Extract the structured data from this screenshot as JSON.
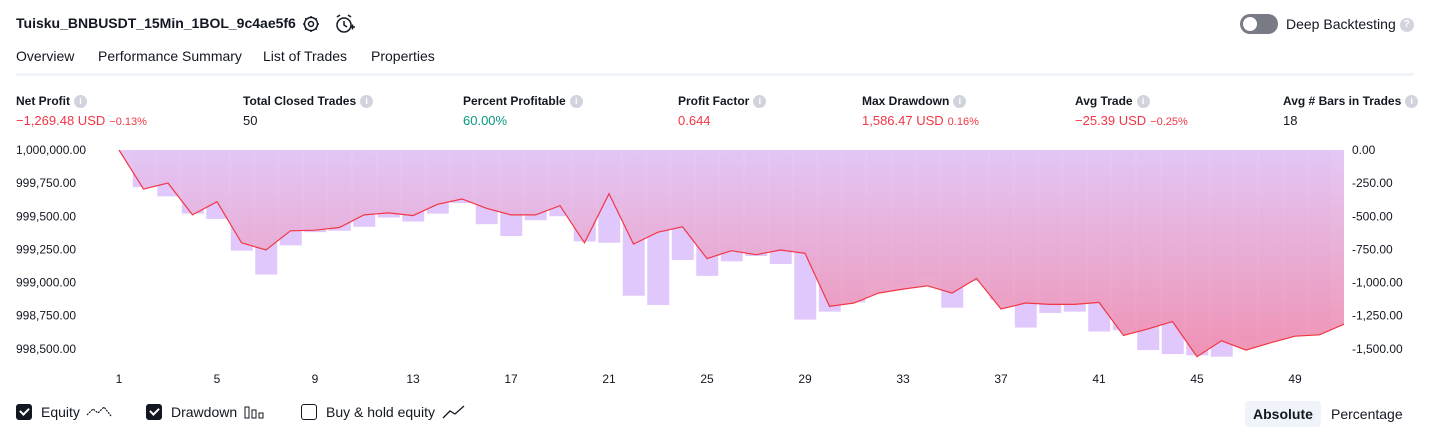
{
  "header": {
    "strategy_name": "Tuisku_BNBUSDT_15Min_1BOL_9c4ae5f6",
    "settings_icon": "gear-icon",
    "alert_icon": "add-alert-icon",
    "deep_backtesting_label": "Deep Backtesting",
    "deep_backtesting_enabled": false,
    "help_icon": "question-icon"
  },
  "tabs": [
    {
      "label": "Overview",
      "active": true
    },
    {
      "label": "Performance Summary",
      "active": false
    },
    {
      "label": "List of Trades",
      "active": false
    },
    {
      "label": "Properties",
      "active": false
    }
  ],
  "metrics": [
    {
      "label": "Net Profit",
      "value": "−1,269.48 USD",
      "sub": "−0.13%",
      "color": "#f23645"
    },
    {
      "label": "Total Closed Trades",
      "value": "50",
      "sub": "",
      "color": "#131722"
    },
    {
      "label": "Percent Profitable",
      "value": "60.00%",
      "sub": "",
      "color": "#089981"
    },
    {
      "label": "Profit Factor",
      "value": "0.644",
      "sub": "",
      "color": "#f23645"
    },
    {
      "label": "Max Drawdown",
      "value": "1,586.47 USD",
      "sub": "0.16%",
      "color": "#f23645"
    },
    {
      "label": "Avg Trade",
      "value": "−25.39 USD",
      "sub": "−0.25%",
      "color": "#f23645"
    },
    {
      "label": "Avg # Bars in Trades",
      "value": "18",
      "sub": "",
      "color": "#131722"
    }
  ],
  "legend": {
    "equity": {
      "label": "Equity",
      "checked": true,
      "icon": "equity-line-icon"
    },
    "drawdown": {
      "label": "Drawdown",
      "checked": true,
      "icon": "drawdown-bars-icon"
    },
    "buy_hold": {
      "label": "Buy & hold equity",
      "checked": false,
      "icon": "buy-hold-line-icon"
    }
  },
  "mode": {
    "absolute_label": "Absolute",
    "percentage_label": "Percentage",
    "selected": "Absolute"
  },
  "colors": {
    "equity_line": "#f23645",
    "drawdown_bar": "#e1c8fc",
    "equity_fill_top": "#e1c4f3",
    "equity_fill_bottom": "#f48fb1"
  },
  "chart_data": {
    "type": "line",
    "x_tick_labels": [
      "1",
      "5",
      "9",
      "13",
      "17",
      "21",
      "25",
      "29",
      "33",
      "37",
      "41",
      "45",
      "49"
    ],
    "left_axis": {
      "ticks": [
        "1,000,000.00",
        "999,750.00",
        "999,500.00",
        "999,250.00",
        "999,000.00",
        "998,750.00",
        "998,500.00"
      ],
      "min": 998400,
      "max": 1000000
    },
    "right_axis": {
      "ticks": [
        "0.00",
        "-250.00",
        "-500.00",
        "-750.00",
        "-1,000.00",
        "-1,250.00",
        "-1,500.00"
      ],
      "min": -1600,
      "max": 0
    },
    "equity": [
      1000000,
      999705,
      999750,
      999510,
      999610,
      999300,
      999245,
      999390,
      999395,
      999415,
      999510,
      999525,
      999505,
      999590,
      999630,
      999560,
      999510,
      999510,
      999580,
      999300,
      999670,
      999290,
      999380,
      999420,
      999180,
      999240,
      999210,
      999245,
      999220,
      998820,
      998845,
      998920,
      998950,
      998975,
      998920,
      999030,
      998800,
      998845,
      998835,
      998835,
      998850,
      998600,
      998650,
      998705,
      998440,
      998560,
      998490,
      998545,
      998595,
      998605,
      998685
    ],
    "drawdown": [
      -280,
      -350,
      -480,
      -520,
      -760,
      -940,
      -720,
      -620,
      -610,
      -580,
      -510,
      -540,
      -480,
      -400,
      -560,
      -650,
      -530,
      -500,
      -690,
      -700,
      -1100,
      -1170,
      -830,
      -950,
      -840,
      -800,
      -860,
      -1280,
      -1220,
      -1150,
      -1030,
      -1010,
      -960,
      -1190,
      -990,
      -1130,
      -1340,
      -1230,
      -1220,
      -1370,
      -1360,
      -1510,
      -1540,
      -1550,
      -1560,
      -1440,
      -1430,
      -1380,
      -1350
    ]
  }
}
